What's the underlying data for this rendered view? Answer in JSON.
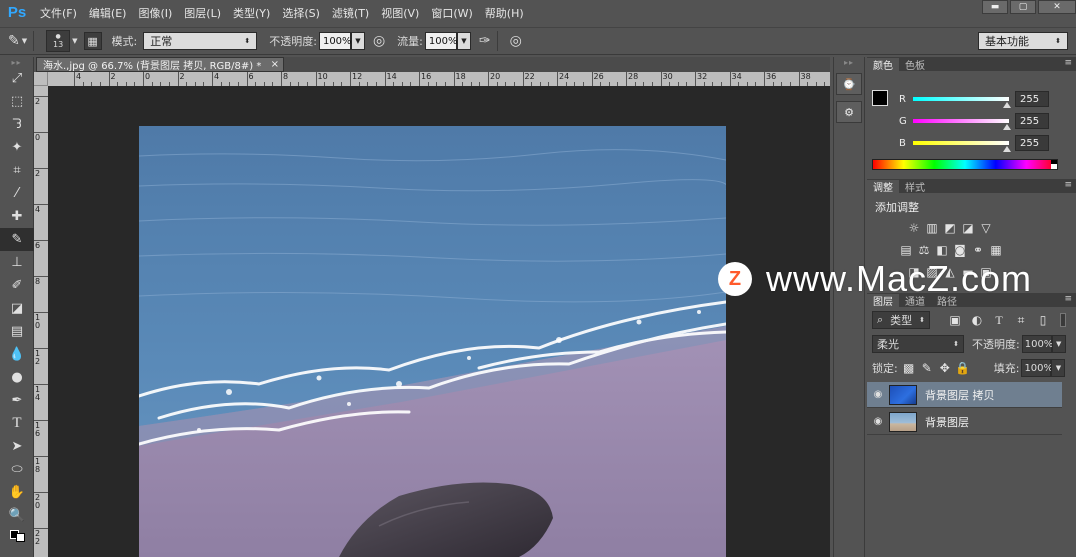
{
  "app": {
    "logo": "Ps"
  },
  "menu": [
    "文件(F)",
    "编辑(E)",
    "图像(I)",
    "图层(L)",
    "类型(Y)",
    "选择(S)",
    "滤镜(T)",
    "视图(V)",
    "窗口(W)",
    "帮助(H)"
  ],
  "window_controls": {
    "minimize": "▬",
    "restore": "▢",
    "close": "✕"
  },
  "options": {
    "brush_size": "13",
    "mode_label": "模式:",
    "mode_value": "正常",
    "opacity_label": "不透明度:",
    "opacity_value": "100%",
    "flow_label": "流量:",
    "flow_value": "100%",
    "workspace": "基本功能"
  },
  "document": {
    "tab_title": "海水.,jpg @ 66.7% (背景图层 拷贝, RGB/8#) *",
    "close": "×",
    "ruler_h": [
      "4",
      "2",
      "0",
      "2",
      "4",
      "6",
      "8",
      "10",
      "12",
      "14",
      "16",
      "18",
      "20",
      "22",
      "24",
      "26",
      "28",
      "30",
      "32",
      "34",
      "36",
      "38",
      "40"
    ],
    "ruler_v": [
      "2",
      "0",
      "2",
      "4",
      "6",
      "8",
      "1 0",
      "1 2",
      "1 4",
      "1 6",
      "1 8",
      "2 0",
      "2 2"
    ]
  },
  "color_panel": {
    "tabs": [
      "颜色",
      "色板"
    ],
    "channels": [
      {
        "label": "R",
        "value": "255"
      },
      {
        "label": "G",
        "value": "255"
      },
      {
        "label": "B",
        "value": "255"
      }
    ]
  },
  "adjust_panel": {
    "tabs": [
      "调整",
      "样式"
    ],
    "title": "添加调整"
  },
  "layers_panel": {
    "tabs": [
      "图层",
      "通道",
      "路径"
    ],
    "filter": "类型",
    "blend_mode": "柔光",
    "opacity_label": "不透明度:",
    "opacity_value": "100%",
    "lock_label": "锁定:",
    "fill_label": "填充:",
    "fill_value": "100%",
    "layers": [
      {
        "name": "背景图层 拷贝",
        "selected": true
      },
      {
        "name": "背景图层",
        "selected": false
      }
    ]
  },
  "watermark": {
    "badge": "Z",
    "text": "www.MacZ.com"
  },
  "colors": {
    "accent": "#31a8ff",
    "selected_layer": "#6f7f90",
    "watermark_orange": "#ff5a2b"
  }
}
